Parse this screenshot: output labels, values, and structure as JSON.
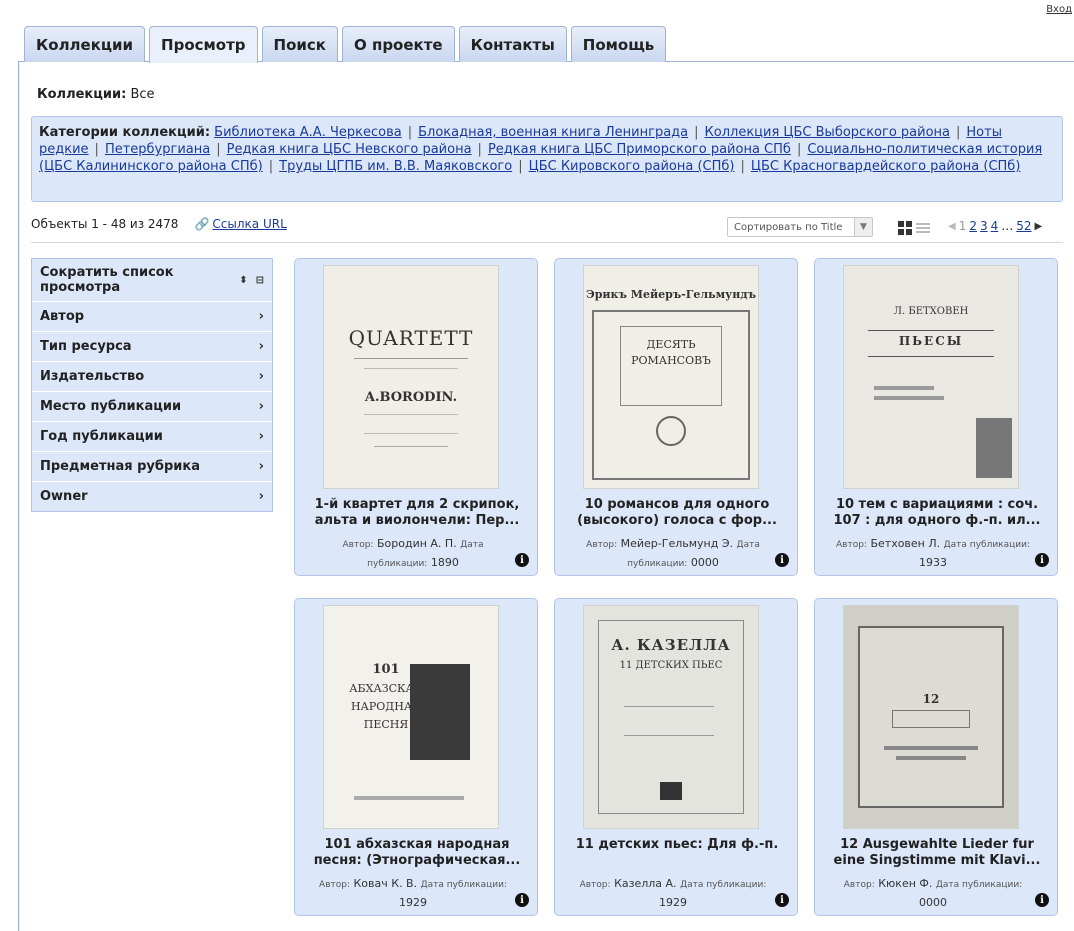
{
  "header": {
    "login": "Вход"
  },
  "tabs": [
    {
      "label": "Коллекции",
      "active": false
    },
    {
      "label": "Просмотр",
      "active": true
    },
    {
      "label": "Поиск",
      "active": false
    },
    {
      "label": "О проекте",
      "active": false
    },
    {
      "label": "Контакты",
      "active": false
    },
    {
      "label": "Помощь",
      "active": false
    }
  ],
  "collections": {
    "label": "Коллекции:",
    "value": "Все"
  },
  "categories": {
    "label": "Категории коллекций:",
    "items": [
      "Библиотека А.А. Черкесова",
      "Блокадная, военная книга Ленинграда",
      "Коллекция ЦБС Выборского района",
      "Ноты редкие",
      "Петербургиана",
      "Редкая книга ЦБС Невского района",
      "Редкая книга ЦБС Приморского района СПб",
      "Социально-политическая история (ЦБС Калининского района СПб)",
      "Труды ЦГПБ им. В.В. Маяковского",
      "ЦБС Кировского района (СПб)",
      "ЦБС Красногвардейского района (СПб)"
    ]
  },
  "results": {
    "count_text": "Объекты 1 - 48 из 2478",
    "url_link": "Ссылка URL"
  },
  "sort": {
    "label": "Сортировать по Title"
  },
  "pager": {
    "pages": [
      "1",
      "2",
      "3",
      "4",
      "…",
      "52"
    ]
  },
  "facets": {
    "header": "Сократить список просмотра",
    "items": [
      "Автор",
      "Тип ресурса",
      "Издательство",
      "Место публикации",
      "Год публикации",
      "Предметная рубрика",
      "Owner"
    ]
  },
  "meta_labels": {
    "author": "Автор:",
    "date": "Дата публикации:"
  },
  "cards": [
    {
      "title": "1-й квартет для 2 скрипок, альта и виолончели: Пер...",
      "author": "Бородин А. П.",
      "date": "1890"
    },
    {
      "title": "10 романсов для одного (высокого) голоса с фор...",
      "author": "Мейер-Гельмунд Э.",
      "date": "0000"
    },
    {
      "title": "10 тем с вариациями : соч. 107 : для одного ф.-п. ил...",
      "author": "Бетховен Л.",
      "date": "1933"
    },
    {
      "title": "101 абхазская народная песня: (Этнографическая...",
      "author": "Ковач К. В.",
      "date": "1929"
    },
    {
      "title": "11 детских пьес: Для ф.-п.",
      "author": "Казелла А.",
      "date": "1929"
    },
    {
      "title": "12 Ausgewahlte Lieder fur eine Singstimme mit Klavi...",
      "author": "Кюкен Ф.",
      "date": "0000"
    }
  ],
  "covers": {
    "c1": {
      "line1": "QUARTETT",
      "line2": "A.BORODIN."
    },
    "c2": {
      "line1": "Эрикъ Мейеръ-Гельмундъ",
      "line2": "ДЕСЯТЬ",
      "line3": "РОМАНСОВЪ"
    },
    "c3": {
      "line1": "Л. БЕТХОВЕН",
      "line2": "ПЬЕСЫ"
    },
    "c4": {
      "line1": "101",
      "line2": "АБХАЗСКАЯ",
      "line3": "НАРОДНАЯ",
      "line4": "ПЕСНЯ"
    },
    "c5": {
      "line1": "А. КАЗЕЛЛА",
      "line2": "11 ДЕТСКИХ ПЬЕС"
    },
    "c6": {
      "line1": "12"
    }
  }
}
